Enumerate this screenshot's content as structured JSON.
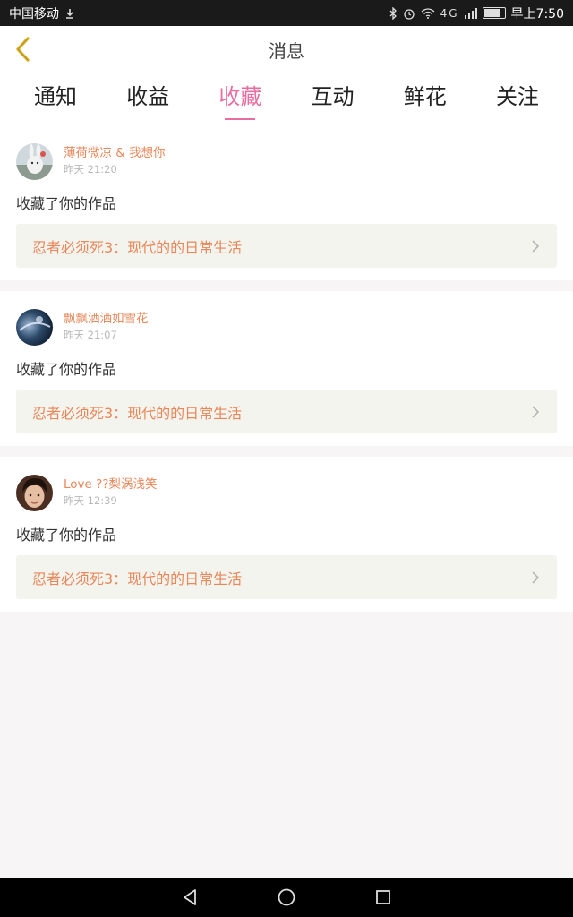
{
  "status_bar": {
    "carrier": "中国移动",
    "time": "早上7:50",
    "network": "4G"
  },
  "header": {
    "title": "消息"
  },
  "tabs": [
    {
      "label": "通知",
      "active": false
    },
    {
      "label": "收益",
      "active": false
    },
    {
      "label": "收藏",
      "active": true
    },
    {
      "label": "互动",
      "active": false
    },
    {
      "label": "鲜花",
      "active": false
    },
    {
      "label": "关注",
      "active": false
    }
  ],
  "messages": [
    {
      "username": "薄荷微凉 & 我想你",
      "time": "昨天 21:20",
      "action": "收藏了你的作品",
      "work_title": "忍者必须死3：现代的的日常生活"
    },
    {
      "username": "飘飘洒洒如雪花",
      "time": "昨天 21:07",
      "action": "收藏了你的作品",
      "work_title": "忍者必须死3：现代的的日常生活"
    },
    {
      "username": "Love ??梨涡浅笑",
      "time": "昨天 12:39",
      "action": "收藏了你的作品",
      "work_title": "忍者必须死3：现代的的日常生活"
    }
  ],
  "colors": {
    "accent": "#e86da0",
    "name": "#e8875a",
    "back_icon": "#e0b52e"
  },
  "icons": {
    "back": "chevron-left-icon",
    "status": [
      "download-icon",
      "bluetooth-icon",
      "alarm-icon",
      "wifi-icon",
      "signal-icon",
      "battery-icon"
    ],
    "nav": [
      "back-triangle-icon",
      "home-circle-icon",
      "recents-square-icon"
    ]
  }
}
